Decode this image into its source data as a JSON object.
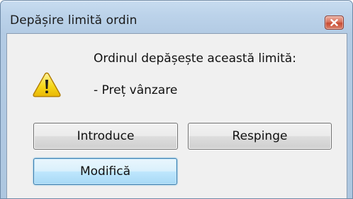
{
  "dialog": {
    "title": "Depășire limită ordin",
    "close_icon": "close-icon",
    "icon": "warning-icon",
    "message": "Ordinul depășește această limită:",
    "detail": "- Preț vânzare"
  },
  "buttons": {
    "introduce_label": "Introduce",
    "respinge_label": "Respinge",
    "modifica_label": "Modifică"
  },
  "colors": {
    "close_button": "#c84b33",
    "warning_fill": "#f5d60f",
    "focused_button": "#bee6fd"
  }
}
